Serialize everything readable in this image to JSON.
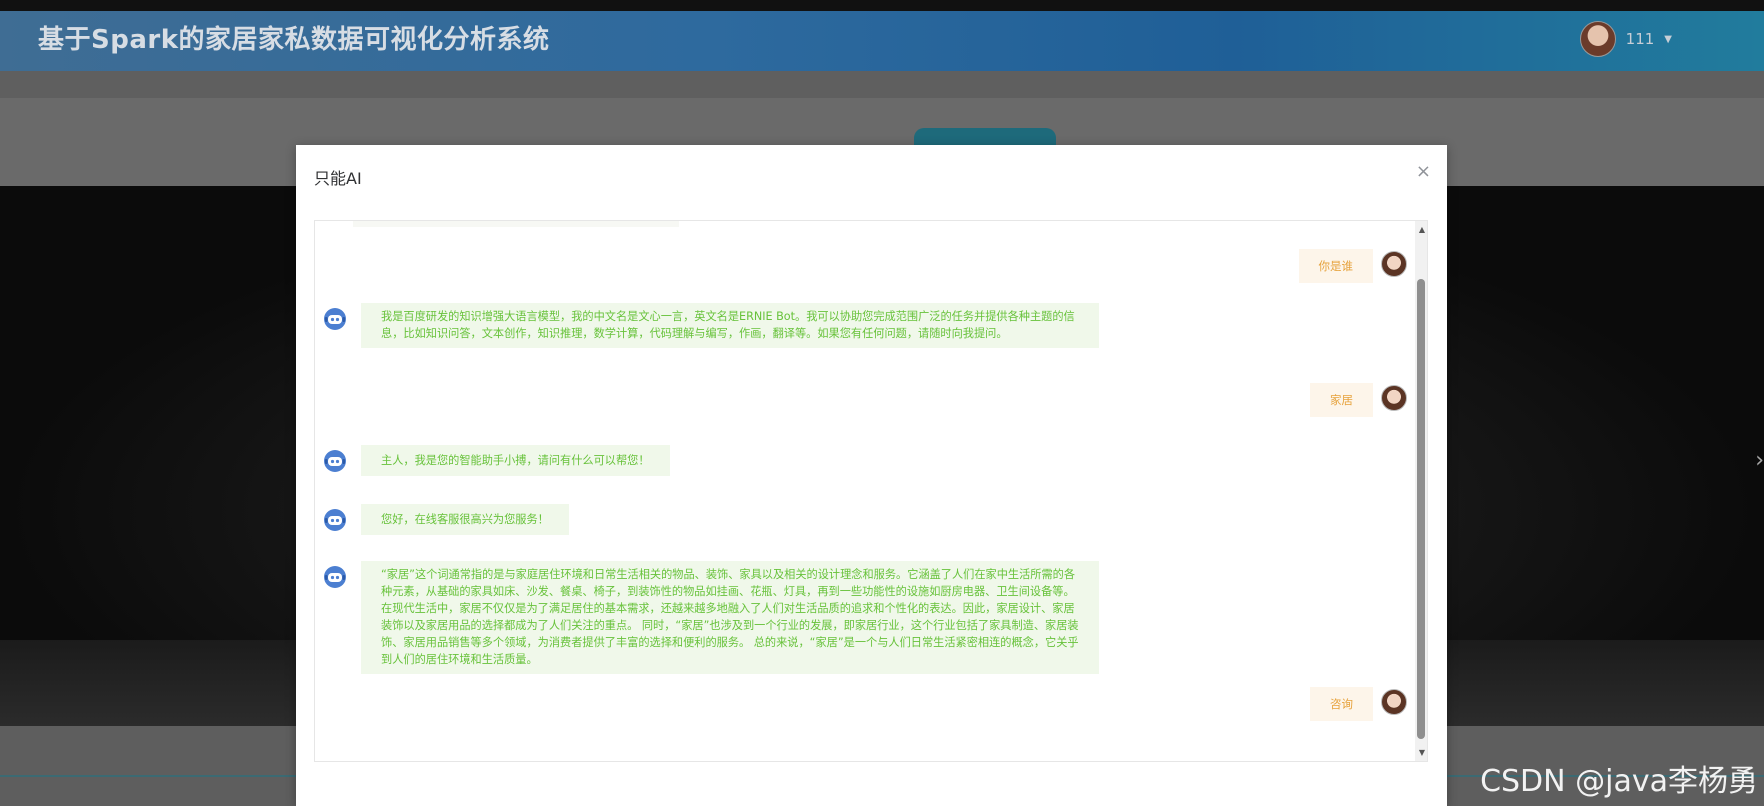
{
  "app": {
    "title": "基于Spark的家居家私数据可视化分析系统",
    "user_name": "111"
  },
  "modal": {
    "title": "只能AI"
  },
  "messages": [
    {
      "role": "user",
      "text": "你是谁"
    },
    {
      "role": "bot",
      "text": "我是百度研发的知识增强大语言模型，我的中文名是文心一言，英文名是ERNIE Bot。我可以协助您完成范围广泛的任务并提供各种主题的信息，比如知识问答，文本创作，知识推理，数学计算，代码理解与编写，作画，翻译等。如果您有任何问题，请随时向我提问。"
    },
    {
      "role": "user",
      "text": "家居"
    },
    {
      "role": "bot",
      "text": "主人，我是您的智能助手小搏，请问有什么可以帮您！"
    },
    {
      "role": "bot",
      "text": "您好，在线客服很高兴为您服务！"
    },
    {
      "role": "bot",
      "text": "“家居”这个词通常指的是与家庭居住环境和日常生活相关的物品、装饰、家具以及相关的设计理念和服务。它涵盖了人们在家中生活所需的各种元素，从基础的家具如床、沙发、餐桌、椅子，到装饰性的物品如挂画、花瓶、灯具，再到一些功能性的设施如厨房电器、卫生间设备等。 在现代生活中，家居不仅仅是为了满足居住的基本需求，还越来越多地融入了人们对生活品质的追求和个性化的表达。因此，家居设计、家居装饰以及家居用品的选择都成为了人们关注的重点。 同时，“家居”也涉及到一个行业的发展，即家居行业，这个行业包括了家具制造、家居装饰、家居用品销售等多个领域，为消费者提供了丰富的选择和便利的服务。 总的来说，“家居”是一个与人们日常生活紧密相连的概念，它关乎到人们的居住环境和生活质量。"
    },
    {
      "role": "user",
      "text": "咨询"
    }
  ],
  "watermark": "CSDN @java李杨勇"
}
